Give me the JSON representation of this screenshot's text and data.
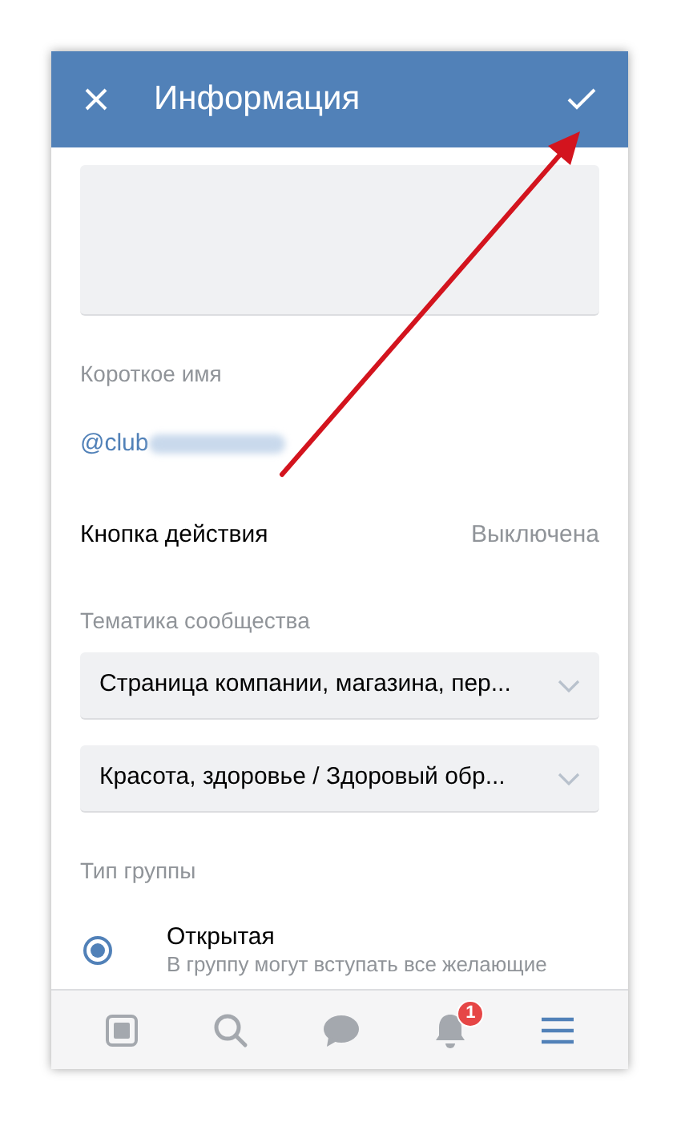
{
  "header": {
    "title": "Информация"
  },
  "short_name": {
    "label": "Короткое имя",
    "value": "@club"
  },
  "action_button": {
    "label": "Кнопка действия",
    "value": "Выключена"
  },
  "topic": {
    "label": "Тематика сообщества",
    "dropdowns": [
      "Страница компании, магазина, пер...",
      "Красота, здоровье / Здоровый обр..."
    ]
  },
  "group_type": {
    "label": "Тип группы",
    "options": [
      {
        "title": "Открытая",
        "description": "В группу могут вступать все желающие",
        "selected": true
      }
    ]
  },
  "tab_bar": [
    {
      "kind": "news",
      "selected": false
    },
    {
      "kind": "search",
      "selected": false
    },
    {
      "kind": "messages",
      "selected": false
    },
    {
      "kind": "notifications",
      "selected": false,
      "badge": "1"
    },
    {
      "kind": "menu",
      "selected": true
    }
  ]
}
